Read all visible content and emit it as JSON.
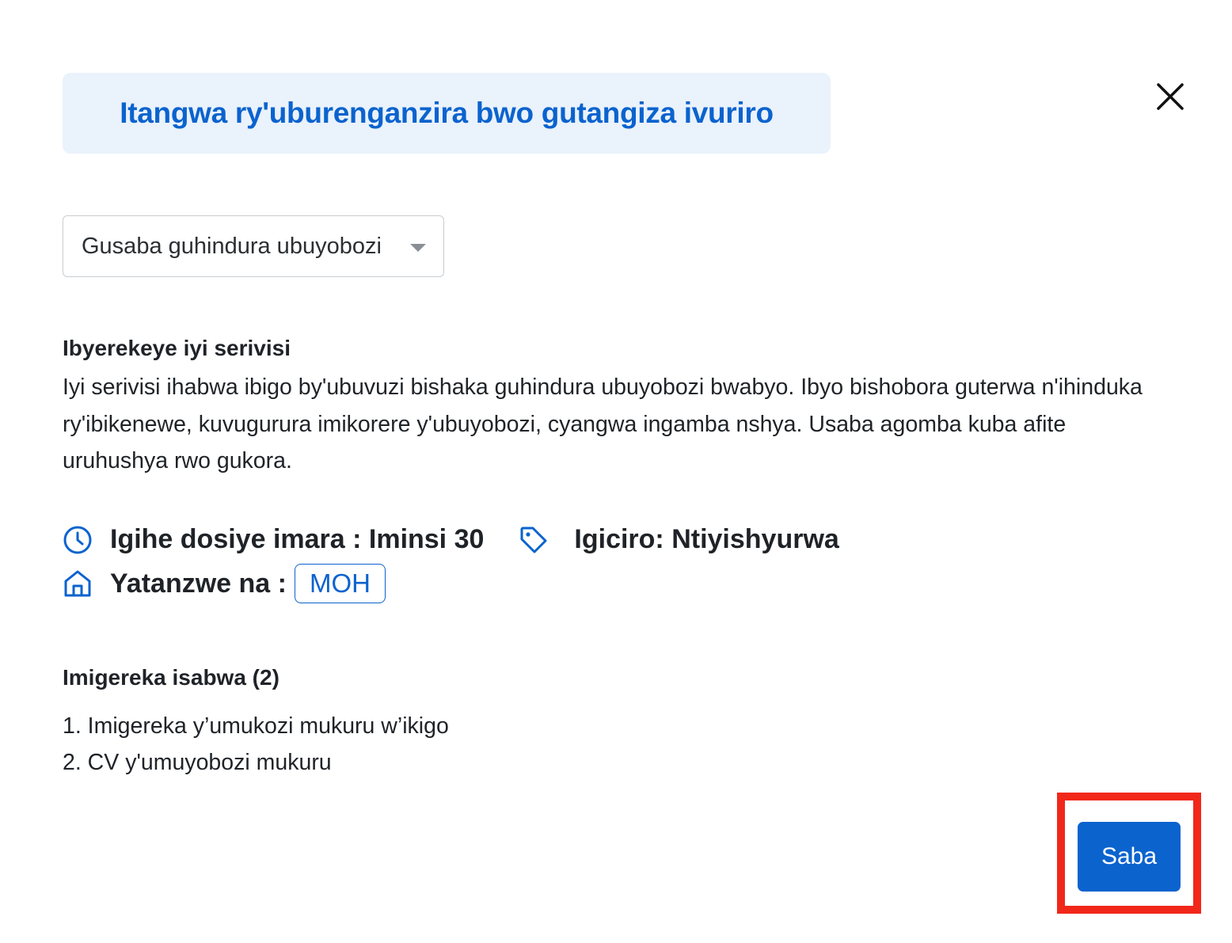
{
  "dialog": {
    "title": "Itangwa ry'uburenganzira bwo gutangiza ivuriro",
    "close_icon": "close-icon"
  },
  "service_select": {
    "selected": "Gusaba guhindura ubuyobozi"
  },
  "about": {
    "heading": "Ibyerekeye iyi serivisi",
    "description": "Iyi serivisi ihabwa ibigo by'ubuvuzi bishaka guhindura ubuyobozi bwabyo. Ibyo bishobora guterwa n'ihinduka ry'ibikenewe, kuvugurura imikorere y'ubuyobozi, cyangwa ingamba nshya. Usaba agomba kuba afite uruhushya rwo gukora."
  },
  "meta": {
    "duration": "Igihe dosiye imara : Iminsi 30",
    "price": "Igiciro: Ntiyishyurwa",
    "issuer_label": "Yatanzwe na :",
    "issuer": "MOH",
    "icons": {
      "duration": "clock-icon",
      "price": "tag-icon",
      "issuer": "home-icon"
    }
  },
  "attachments": {
    "heading": "Imigereka isabwa (2)",
    "items": [
      "1. Imigereka y’umukozi mukuru w’ikigo",
      "2. CV y'umuyobozi mukuru"
    ]
  },
  "actions": {
    "submit_label": "Saba"
  },
  "colors": {
    "accent": "#0b63ce",
    "banner_bg": "#eaf2fc",
    "highlight": "#f1271a"
  }
}
